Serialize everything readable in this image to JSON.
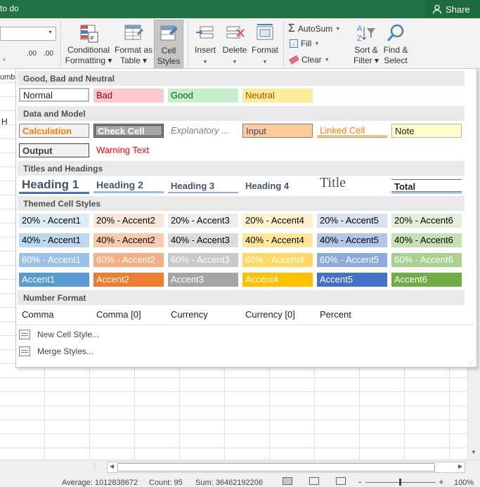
{
  "titlebar": {
    "title": "to do",
    "share_label": "Share"
  },
  "ribbon": {
    "number_format_partial": "umbe",
    "conditional_formatting": [
      "Conditional",
      "Formatting ▾"
    ],
    "format_as_table": [
      "Format as",
      "Table ▾"
    ],
    "cell_styles": [
      "Cell",
      "Styles ▾"
    ],
    "insert": "Insert",
    "delete": "Delete",
    "format": "Format",
    "autosum": "AutoSum",
    "fill": "Fill",
    "clear": "Clear",
    "sort_filter": [
      "Sort &",
      "Filter ▾"
    ],
    "find_select": [
      "Find &",
      "Select ▾"
    ],
    "number_symbols": [
      ",",
      ".00",
      ".00"
    ]
  },
  "grid": {
    "visible_column": "H"
  },
  "panel": {
    "sections": {
      "good_bad_neutral": "Good, Bad and Neutral",
      "data_model": "Data and Model",
      "titles_headings": "Titles and Headings",
      "themed": "Themed Cell Styles",
      "number_format": "Number Format"
    },
    "good_bad_neutral": [
      "Normal",
      "Bad",
      "Good",
      "Neutral"
    ],
    "data_model_row1": [
      "Calculation",
      "Check Cell",
      "Explanatory ...",
      "Input",
      "Linked Cell",
      "Note"
    ],
    "data_model_row2": [
      "Output",
      "Warning Text"
    ],
    "titles_headings": [
      "Heading 1",
      "Heading 2",
      "Heading 3",
      "Heading 4",
      "Title",
      "Total"
    ],
    "themed_20": [
      "20% - Accent1",
      "20% - Accent2",
      "20% - Accent3",
      "20% - Accent4",
      "20% - Accent5",
      "20% - Accent6"
    ],
    "themed_40": [
      "40% - Accent1",
      "40% - Accent2",
      "40% - Accent3",
      "40% - Accent4",
      "40% - Accent5",
      "40% - Accent6"
    ],
    "themed_60": [
      "60% - Accent1",
      "60% - Accent2",
      "60% - Accent3",
      "60% - Accent4",
      "60% - Accent5",
      "60% - Accent6"
    ],
    "accents": [
      "Accent1",
      "Accent2",
      "Accent3",
      "Accent4",
      "Accent5",
      "Accent6"
    ],
    "number_formats": [
      "Comma",
      "Comma [0]",
      "Currency",
      "Currency [0]",
      "Percent"
    ],
    "new_cell_style": "New Cell Style...",
    "merge_styles": "Merge Styles..."
  },
  "statusbar": {
    "average": "Average: 1012838672",
    "count": "Count: 95",
    "sum": "Sum: 36462192206",
    "minus": "-",
    "plus": "+",
    "zoom": "100%"
  },
  "colors": {
    "excel_green": "#217346",
    "accent1": "#5b9bd5",
    "accent2": "#ed7d31",
    "accent3": "#a5a5a5",
    "accent4": "#ffc000",
    "accent5": "#4472c4",
    "accent6": "#70ad47"
  }
}
